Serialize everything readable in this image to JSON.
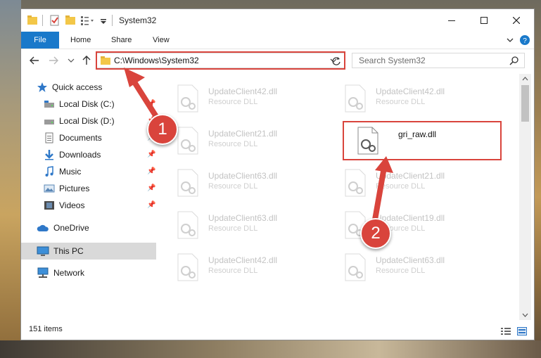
{
  "window": {
    "title": "System32",
    "ribbon_tabs": {
      "file": "File",
      "home": "Home",
      "share": "Share",
      "view": "View"
    },
    "address": "C:\\Windows\\System32",
    "search_placeholder": "Search System32"
  },
  "sidebar": {
    "quick_access": "Quick access",
    "local_disk_c": "Local Disk (C:)",
    "local_disk_d": "Local Disk (D:)",
    "documents": "Documents",
    "downloads": "Downloads",
    "music": "Music",
    "pictures": "Pictures",
    "videos": "Videos",
    "onedrive": "OneDrive",
    "this_pc": "This PC",
    "network": "Network"
  },
  "files": [
    {
      "name": "UpdateClient42.dll",
      "type": "Resource DLL"
    },
    {
      "name": "UpdateClient42.dll",
      "type": "Resource DLL"
    },
    {
      "name": "UpdateClient21.dll",
      "type": "Resource DLL"
    },
    {
      "name": "gri_raw.dll",
      "type": ""
    },
    {
      "name": "UpdateClient63.dll",
      "type": "Resource DLL"
    },
    {
      "name": "UpdateClient21.dll",
      "type": "Resource DLL"
    },
    {
      "name": "UpdateClient63.dll",
      "type": "Resource DLL"
    },
    {
      "name": "UpdateClient19.dll",
      "type": "Resource DLL"
    },
    {
      "name": "UpdateClient42.dll",
      "type": "Resource DLL"
    },
    {
      "name": "UpdateClient63.dll",
      "type": "Resource DLL"
    }
  ],
  "status": {
    "items": "151 items"
  },
  "annotations": {
    "step1": "1",
    "step2": "2"
  },
  "colors": {
    "accent": "#1979ca",
    "highlight": "#d9443c"
  }
}
